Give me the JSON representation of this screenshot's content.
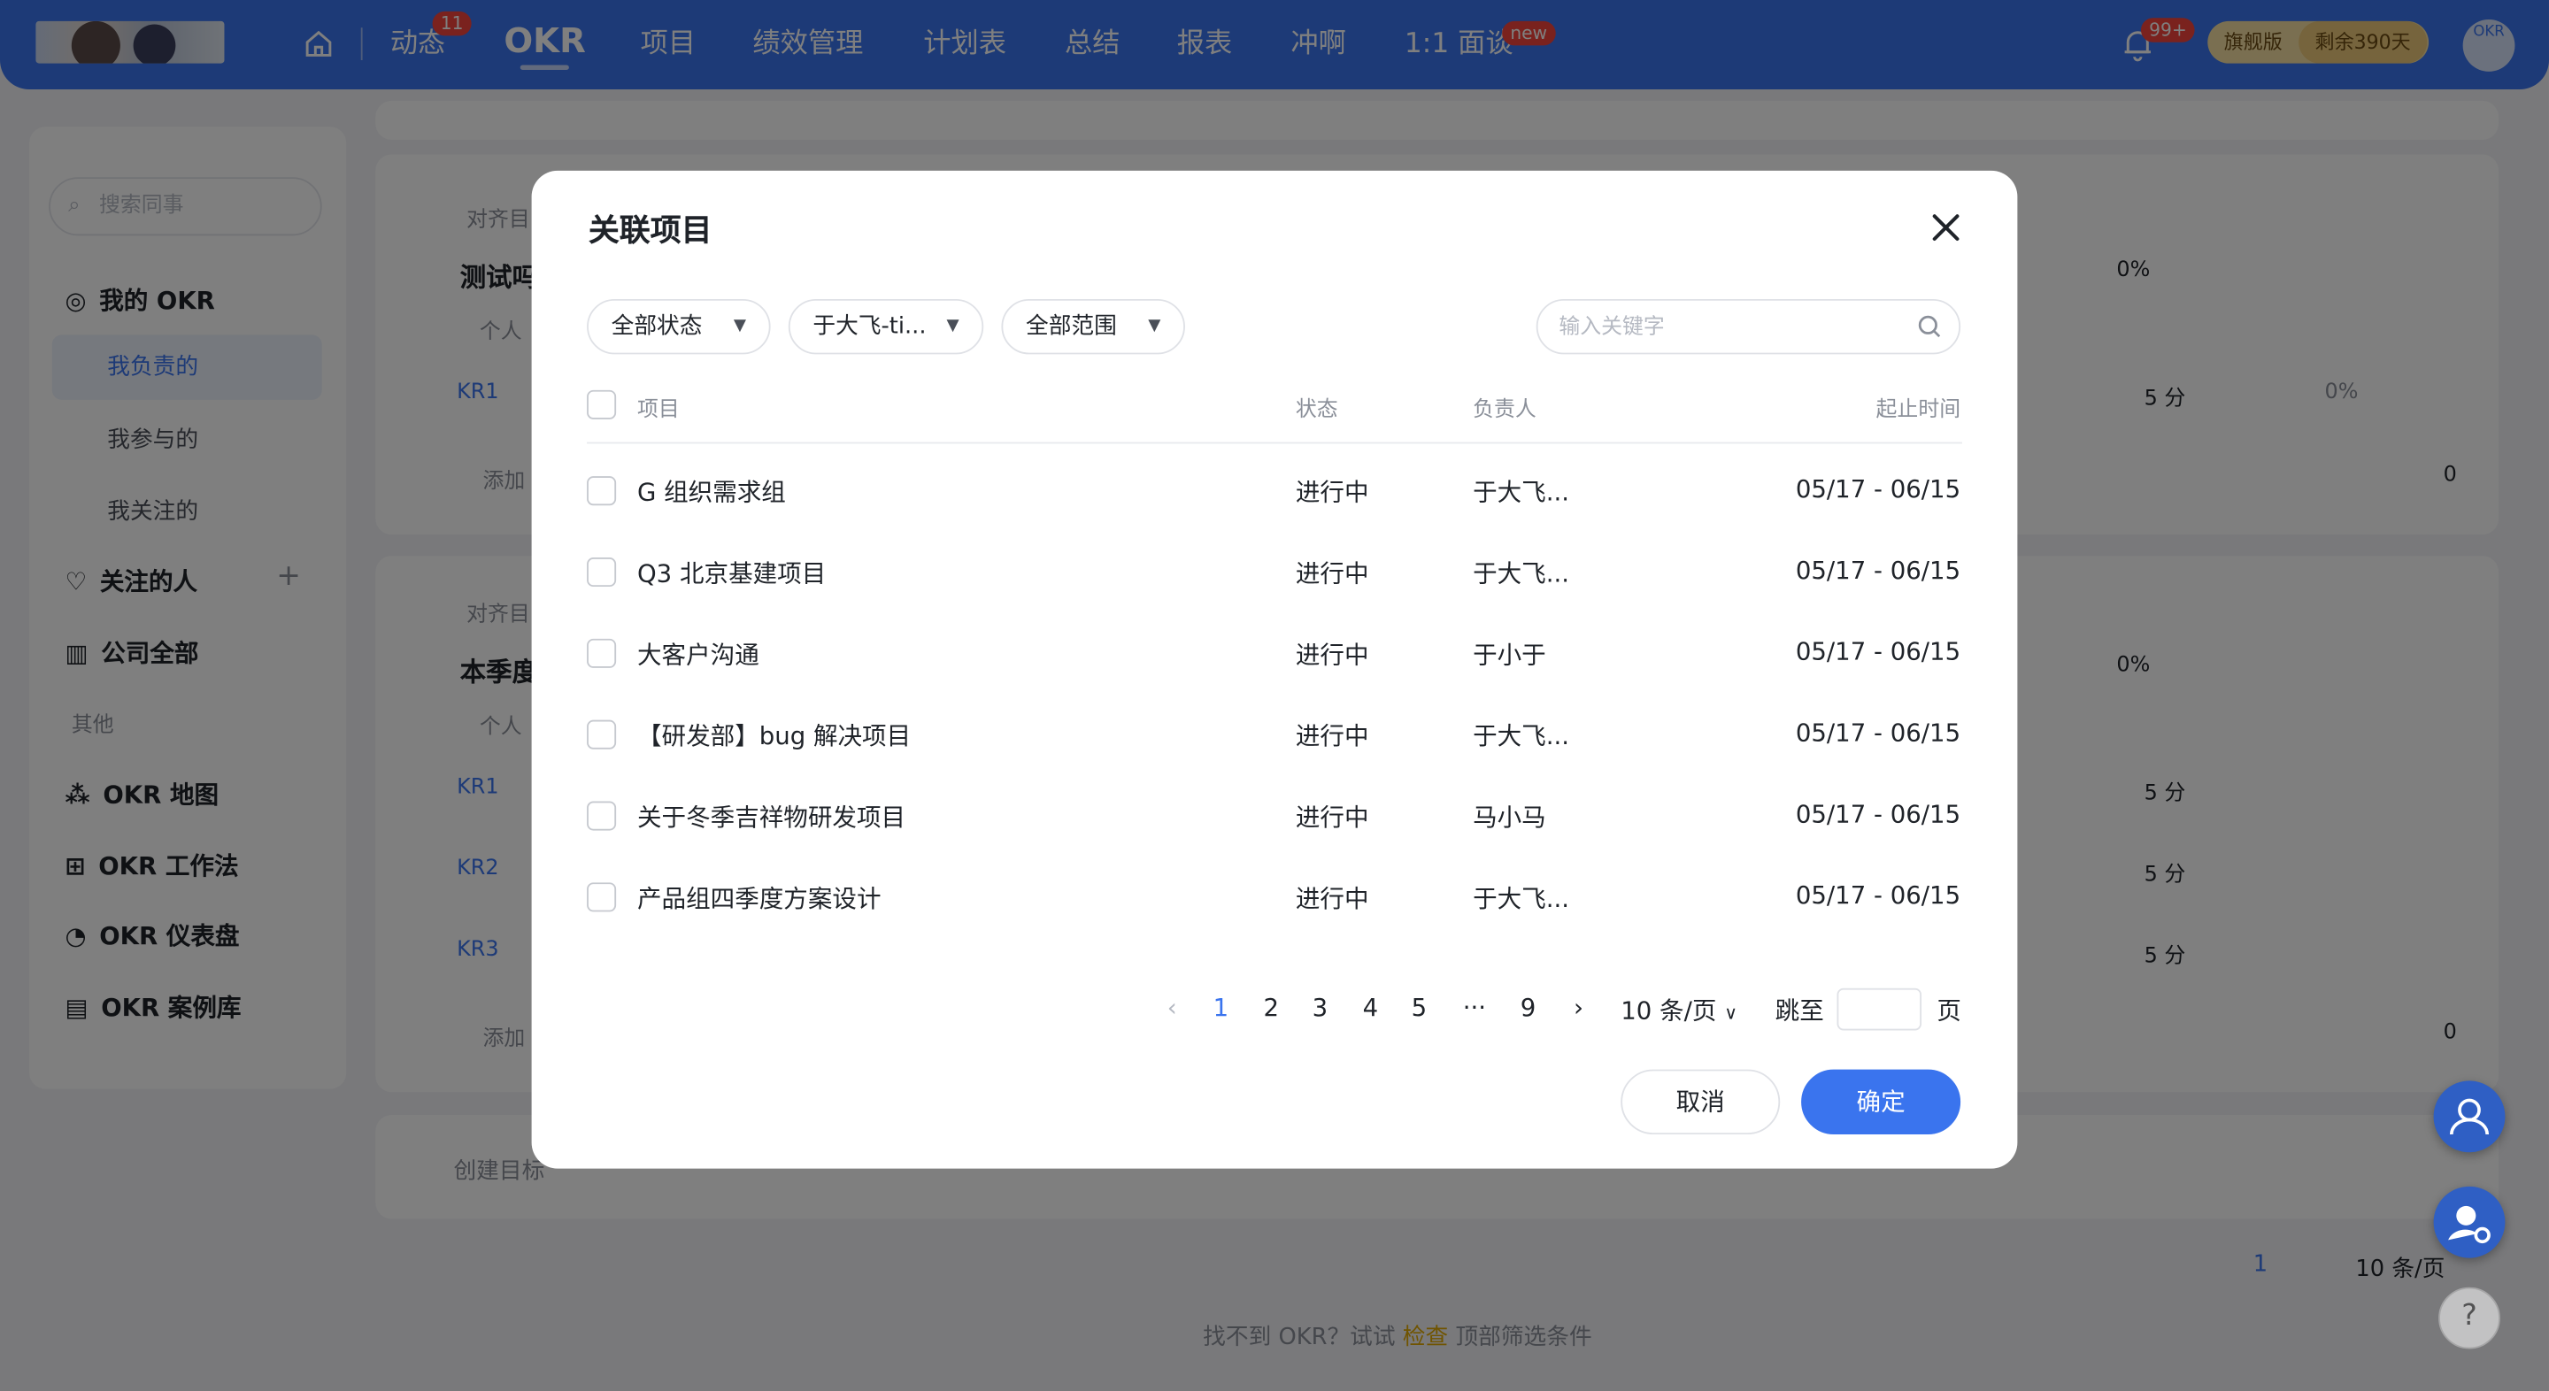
{
  "topnav": {
    "items": [
      "动态",
      "OKR",
      "项目",
      "绩效管理",
      "计划表",
      "总结",
      "报表",
      "冲啊",
      "1:1 面谈"
    ],
    "dynamic_badge": "11",
    "interview_badge": "new",
    "notification_badge": "99+",
    "edition": "旗舰版",
    "remaining": "剩余390天",
    "avatar_text": "OKR"
  },
  "sidebar": {
    "search_placeholder": "搜索同事",
    "my_okr": "我的 OKR",
    "my_responsible": "我负责的",
    "my_participated": "我参与的",
    "my_followed": "我关注的",
    "followed_people": "关注的人",
    "company_all": "公司全部",
    "other_section": "其他",
    "okr_map": "OKR 地图",
    "okr_method": "OKR 工作法",
    "okr_dashboard": "OKR 仪表盘",
    "okr_cases": "OKR 案例库"
  },
  "background": {
    "align": "对齐目",
    "obj1_title": "测试吗",
    "obj2_title": "本季度",
    "personal": "个人",
    "kr1": "KR1",
    "kr2": "KR2",
    "kr3": "KR3",
    "add": "添加",
    "progress": "0%",
    "score": "5 分",
    "likes": "0",
    "create_goal": "创建目标",
    "footer_hint": "找不到 OKR？试试",
    "footer_check": "检查",
    "footer_tail": "顶部筛选条件",
    "page_current": "1",
    "page_size": "10 条/页"
  },
  "modal": {
    "title": "关联项目",
    "filters": {
      "status": "全部状态",
      "owner": "于大飞-ti...",
      "scope": "全部范围"
    },
    "search_placeholder": "输入关键字",
    "columns": {
      "project": "项目",
      "status": "状态",
      "owner": "负责人",
      "period": "起止时间"
    },
    "rows": [
      {
        "name": "G 组织需求组",
        "status": "进行中",
        "owner": "于大飞...",
        "period": "05/17 - 06/15"
      },
      {
        "name": "Q3 北京基建项目",
        "status": "进行中",
        "owner": "于大飞...",
        "period": "05/17 - 06/15"
      },
      {
        "name": "大客户沟通",
        "status": "进行中",
        "owner": "于小于",
        "period": "05/17 - 06/15"
      },
      {
        "name": "【研发部】bug 解决项目",
        "status": "进行中",
        "owner": "于大飞...",
        "period": "05/17 - 06/15"
      },
      {
        "name": "关于冬季吉祥物研发项目",
        "status": "进行中",
        "owner": "马小马",
        "period": "05/17 - 06/15"
      },
      {
        "name": "产品组四季度方案设计",
        "status": "进行中",
        "owner": "于大飞...",
        "period": "05/17 - 06/15"
      }
    ],
    "pagination": {
      "pages": [
        "1",
        "2",
        "3",
        "4",
        "5",
        "···",
        "9"
      ],
      "current": "1",
      "page_size": "10 条/页",
      "jump_label": "跳至",
      "page_unit": "页"
    },
    "cancel": "取消",
    "confirm": "确定"
  },
  "colors": {
    "primary": "#3a74ee",
    "badge": "#f5453d",
    "overlay": "rgba(0,0,0,0.5)"
  }
}
